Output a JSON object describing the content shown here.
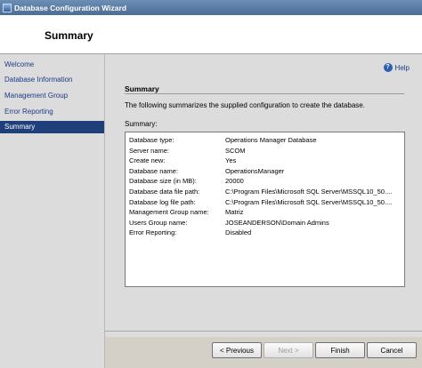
{
  "window": {
    "title": "Database Configuration Wizard"
  },
  "header": {
    "title": "Summary"
  },
  "sidebar": {
    "items": [
      {
        "label": "Welcome"
      },
      {
        "label": "Database Information"
      },
      {
        "label": "Management Group"
      },
      {
        "label": "Error Reporting"
      },
      {
        "label": "Summary",
        "active": true
      }
    ]
  },
  "main": {
    "help_label": "Help",
    "section_heading": "Summary",
    "description": "The following summarizes the supplied configuration to create the database.",
    "summary_label": "Summary:",
    "rows": [
      {
        "key": "Database type:",
        "value": "Operations Manager Database"
      },
      {
        "key": "Server name:",
        "value": "SCOM"
      },
      {
        "key": "Create new:",
        "value": "Yes"
      },
      {
        "key": "Database name:",
        "value": "OperationsManager"
      },
      {
        "key": "Database size (in MB):",
        "value": "20000"
      },
      {
        "key": "Database data file path:",
        "value": "C:\\Program Files\\Microsoft SQL Server\\MSSQL10_50...."
      },
      {
        "key": "Database log file path:",
        "value": "C:\\Program Files\\Microsoft SQL Server\\MSSQL10_50...."
      },
      {
        "key": "Management Group name:",
        "value": "Matriz"
      },
      {
        "key": "Users Group name:",
        "value": "JOSEANDERSON\\Domain Admins"
      },
      {
        "key": "Error Reporting:",
        "value": "Disabled"
      }
    ]
  },
  "buttons": {
    "previous": "< Previous",
    "next": "Next >",
    "finish": "Finish",
    "cancel": "Cancel"
  }
}
